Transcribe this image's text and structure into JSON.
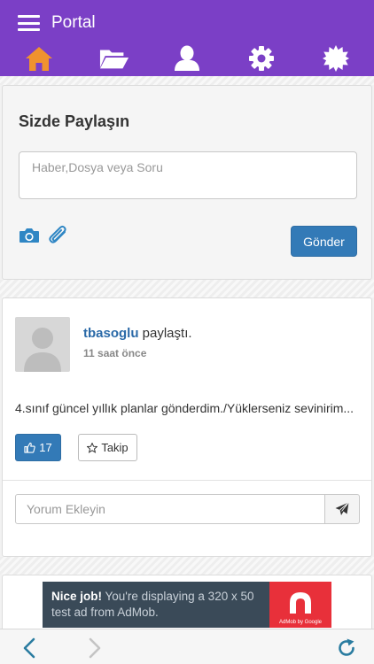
{
  "header": {
    "title": "Portal",
    "nav": [
      {
        "name": "home",
        "icon": "home-icon",
        "active": true,
        "color": "#f0922e"
      },
      {
        "name": "files",
        "icon": "folder-icon",
        "active": false
      },
      {
        "name": "profile",
        "icon": "user-icon",
        "active": false
      },
      {
        "name": "settings",
        "icon": "gear-icon",
        "active": false
      },
      {
        "name": "notifications",
        "icon": "burst-icon",
        "active": false
      }
    ],
    "bg_color": "#7b3fc6"
  },
  "share": {
    "title": "Sizde Paylaşın",
    "input_placeholder": "Haber,Dosya veya Soru",
    "input_value": "",
    "photo_icon": "camera-icon",
    "attach_icon": "paperclip-icon",
    "submit_label": "Gönder"
  },
  "post": {
    "username": "tbasoglu",
    "action": " paylaştı.",
    "time": "11 saat önce",
    "body": "4.sınıf güncel yıllık planlar gönderdim./Yüklerseniz sevinirim...",
    "like_count": "17",
    "like_icon": "thumbs-up-icon",
    "follow_label": "Takip",
    "follow_icon": "star-icon",
    "comment_placeholder": "Yorum Ekleyin",
    "comment_send_icon": "paper-plane-icon"
  },
  "ad": {
    "headline": "Nice job!",
    "text": " You're displaying a 320 x 50 test ad from AdMob.",
    "logo_caption": "AdMob by Google"
  },
  "toolbar": {
    "back_icon": "chevron-left-icon",
    "forward_icon": "chevron-right-icon",
    "reload_icon": "refresh-icon"
  },
  "colors": {
    "accent": "#337ab7",
    "link": "#2b6aa8",
    "toolbar_icon": "#2a7ca0"
  }
}
